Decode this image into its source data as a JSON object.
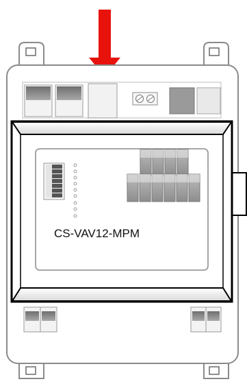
{
  "device": {
    "model_label": "CS-VAV12-MPM"
  },
  "indicator": {
    "icon": "down-arrow-icon",
    "color": "#e8120c"
  },
  "colors": {
    "housing_stroke": "#8a8a8a",
    "cover_stroke": "#000000",
    "connector_dark": "#9a9a9a",
    "connector_light": "#e9e9e9"
  }
}
